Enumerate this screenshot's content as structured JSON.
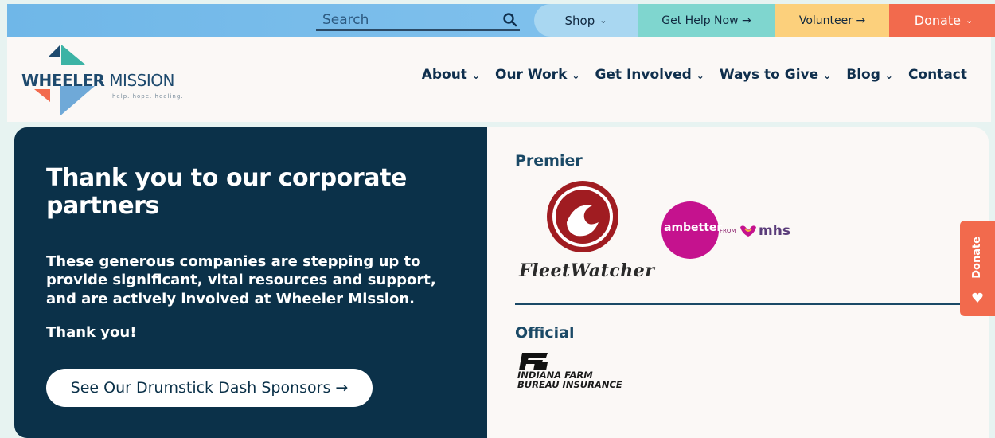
{
  "utility_bar": {
    "search_placeholder": "Search",
    "shop": "Shop",
    "get_help": "Get Help Now →",
    "volunteer": "Volunteer →",
    "donate": "Donate",
    "icons": [
      "search-icon",
      "chevron-down-icon"
    ]
  },
  "header": {
    "logo_name_bold": "WHEELER",
    "logo_name": " MISSION",
    "logo_tagline": "help. hope. healing.",
    "nav": [
      "About",
      "Our Work",
      "Get Involved",
      "Ways to Give",
      "Blog",
      "Contact"
    ]
  },
  "main": {
    "heading": "Thank you to our corporate partners",
    "description": "These generous companies are stepping up to provide significant, vital resources and support, and are actively involved at Wheeler Mission.",
    "thanks": "Thank you!",
    "sponsor_button": "See Our Drumstick Dash Sponsors →"
  },
  "partners": {
    "premier_label": "Premier",
    "official_label": "Official",
    "fleetwatcher": "FleetWatcher",
    "ambetter": "ambetter.",
    "ambetter_from": "FROM",
    "mhs": "mhs",
    "ifb_line1": "INDIANA FARM",
    "ifb_line2": "BUREAU INSURANCE"
  },
  "side_tab": {
    "label": "Donate"
  },
  "colors": {
    "navy": "#0b3149",
    "shop_bg": "#a9d7f1",
    "help_bg": "#7fd6cf",
    "volunteer_bg": "#fcd07c",
    "donate_bg": "#f26a4d",
    "ambetter_pink": "#c5128e"
  }
}
